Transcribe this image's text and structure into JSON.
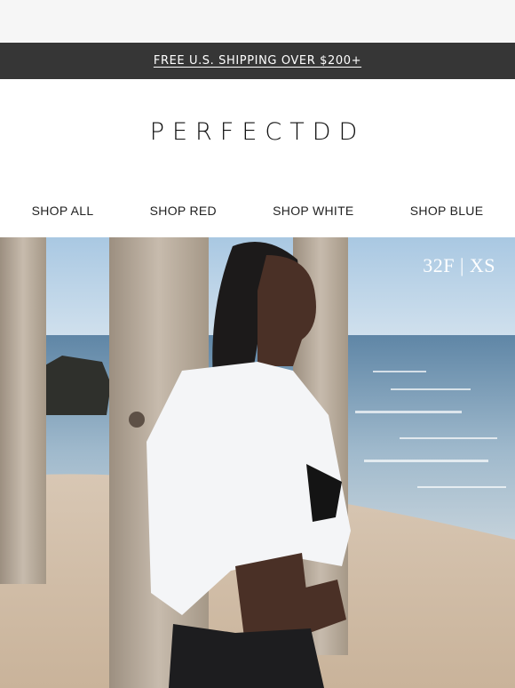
{
  "promo": {
    "text": "FREE U.S. SHIPPING OVER $200+"
  },
  "brand": {
    "logo_text": "PERFECTDD"
  },
  "nav": {
    "items": [
      {
        "label": "SHOP ALL"
      },
      {
        "label": "SHOP RED"
      },
      {
        "label": "SHOP WHITE"
      },
      {
        "label": "SHOP BLUE"
      }
    ]
  },
  "hero": {
    "size_label": "32F | XS",
    "colors": {
      "sky": "#b9d3e8",
      "sea": "#7fa0b8",
      "sand": "#d9c6b0",
      "shirt": "#f5f6f8",
      "post": "#b8aa98"
    }
  }
}
